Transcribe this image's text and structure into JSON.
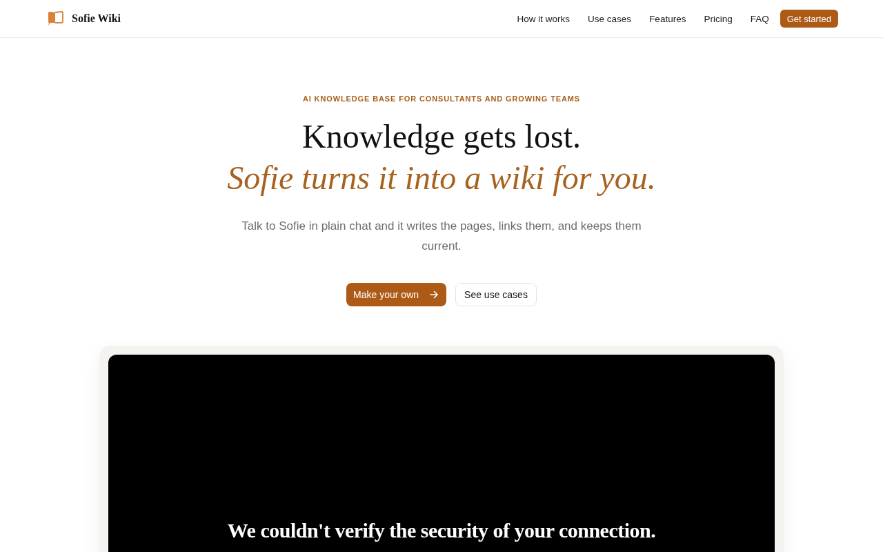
{
  "header": {
    "brand": "Sofie Wiki",
    "nav": [
      "How it works",
      "Use cases",
      "Features",
      "Pricing",
      "FAQ"
    ],
    "cta": "Get started"
  },
  "hero": {
    "eyebrow": "AI KNOWLEDGE BASE FOR CONSULTANTS AND GROWING TEAMS",
    "title": "Knowledge gets lost.",
    "subtitle": "Sofie turns it into a wiki for you.",
    "description": "Talk to Sofie in plain chat and it writes the pages, links them, and keeps them current.",
    "buttons": [
      {
        "label": "Make your own",
        "kind": "primary"
      },
      {
        "label": "See use cases",
        "kind": "secondary"
      }
    ]
  },
  "preview": {
    "message": "We couldn't verify the security of your connection."
  }
}
